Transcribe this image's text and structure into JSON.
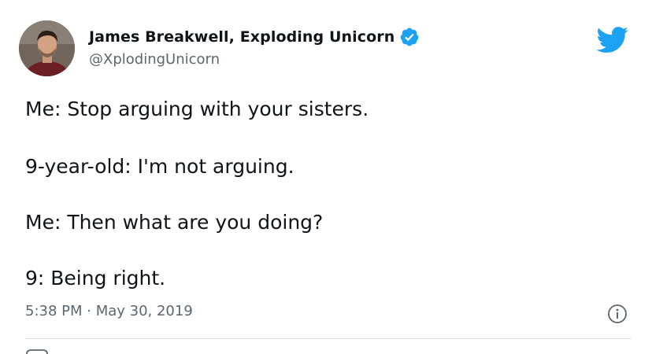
{
  "author": {
    "display_name": "James Breakwell, Exploding Unicorn",
    "handle": "@XplodingUnicorn",
    "verified": true,
    "avatar_icon": "profile-photo"
  },
  "brand": {
    "logo_icon": "twitter-bird-icon",
    "color": "#1da1f2"
  },
  "tweet": {
    "lines": [
      "Me: Stop arguing with your sisters.",
      "9-year-old: I'm not arguing.",
      "Me: Then what are you doing?",
      "9: Being right."
    ],
    "timestamp": "5:38 PM · May 30, 2019"
  },
  "actions": {
    "info_icon": "info-icon"
  }
}
